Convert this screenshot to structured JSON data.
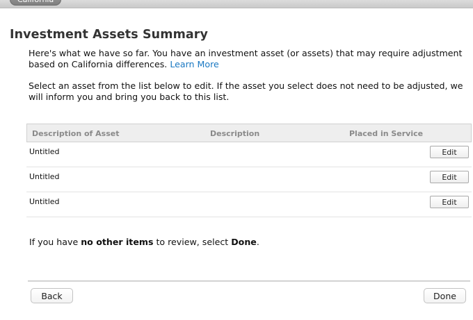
{
  "header": {
    "state_tab": "California"
  },
  "page": {
    "title": "Investment Assets Summary",
    "intro_text": "Here's what we have so far. You have an investment asset (or assets) that may require adjustment based on California differences. ",
    "learn_more": "Learn More",
    "instruction": "Select an asset from the list below to edit. If the asset you select does not need to be adjusted, we will inform you and bring you back to this list."
  },
  "table": {
    "columns": [
      "Description of Asset",
      "Description",
      "Placed in Service"
    ],
    "rows": [
      {
        "name": "Untitled",
        "description": "",
        "placed_in_service": "",
        "action": "Edit"
      },
      {
        "name": "Untitled",
        "description": "",
        "placed_in_service": "",
        "action": "Edit"
      },
      {
        "name": "Untitled",
        "description": "",
        "placed_in_service": "",
        "action": "Edit"
      }
    ]
  },
  "footer": {
    "text_pre": "If you have ",
    "text_bold1": "no other items",
    "text_mid": " to review, select ",
    "text_bold2": "Done",
    "text_post": ".",
    "back_label": "Back",
    "done_label": "Done"
  }
}
